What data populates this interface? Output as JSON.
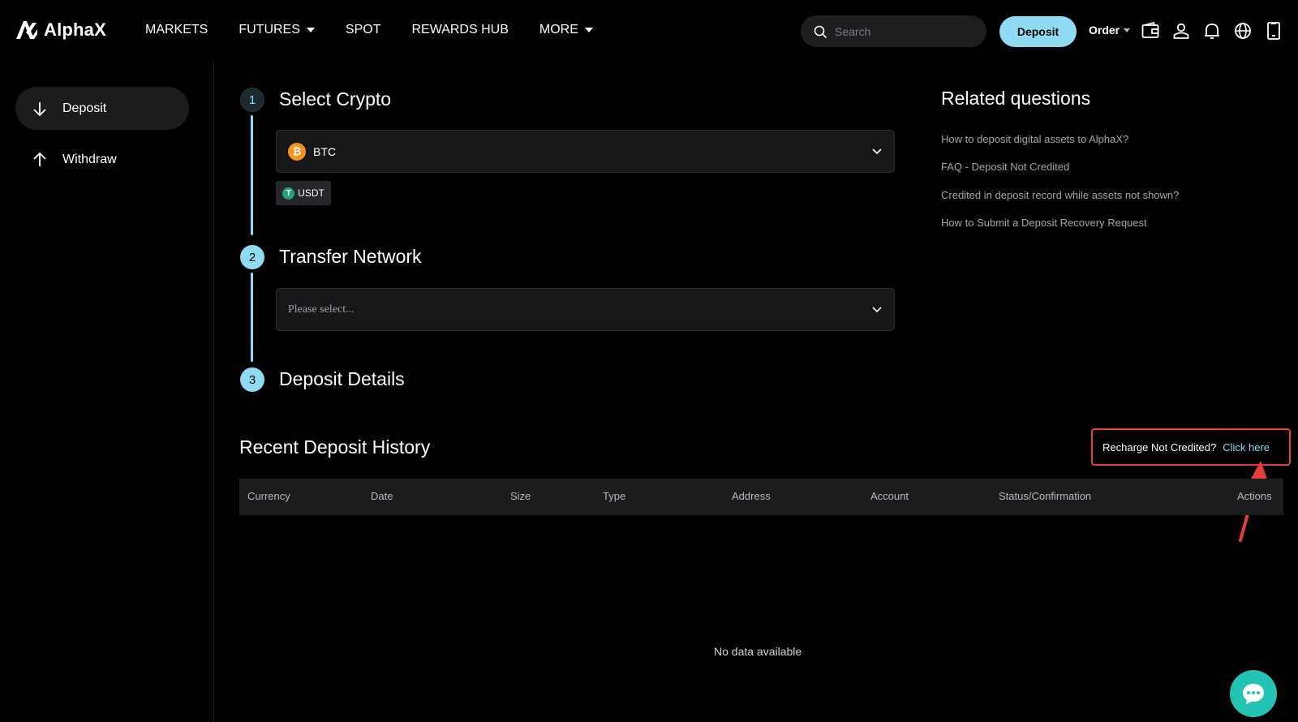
{
  "header": {
    "logo_text": "AlphaX",
    "nav": [
      "MARKETS",
      "FUTURES",
      "SPOT",
      "REWARDS HUB",
      "MORE"
    ],
    "search_placeholder": "Search",
    "deposit_label": "Deposit",
    "order_label": "Order",
    "icons": [
      "wallet-icon",
      "user-icon",
      "bell-icon",
      "globe-icon",
      "mobile-icon"
    ]
  },
  "sidebar": {
    "items": [
      {
        "label": "Deposit",
        "icon": "arrow-down-icon",
        "active": true
      },
      {
        "label": "Withdraw",
        "icon": "arrow-up-icon",
        "active": false
      }
    ]
  },
  "steps": [
    {
      "number": "1",
      "title": "Select Crypto"
    },
    {
      "number": "2",
      "title": "Transfer Network"
    },
    {
      "number": "3",
      "title": "Deposit Details"
    }
  ],
  "crypto_select": {
    "value": "BTC",
    "coin_symbol": "₿"
  },
  "quick_chip": {
    "label": "USDT",
    "coin_symbol": "T"
  },
  "network_select": {
    "placeholder": "Please select..."
  },
  "related": {
    "title": "Related questions",
    "links": [
      "How to deposit digital assets to AlphaX?",
      "FAQ - Deposit Not Credited",
      "Credited in deposit record while assets not shown?",
      "How to Submit a Deposit Recovery Request"
    ]
  },
  "history": {
    "title": "Recent Deposit History",
    "recharge_text": "Recharge Not Credited?",
    "recharge_link": "Click here",
    "columns": [
      "Currency",
      "Date",
      "Size",
      "Type",
      "Address",
      "Account",
      "Status/Confirmation",
      "Actions"
    ],
    "empty_text": "No data available"
  },
  "colors": {
    "accent": "#8fdbf3",
    "highlight_box": "#e53c3c",
    "chat": "#23c4b4"
  }
}
